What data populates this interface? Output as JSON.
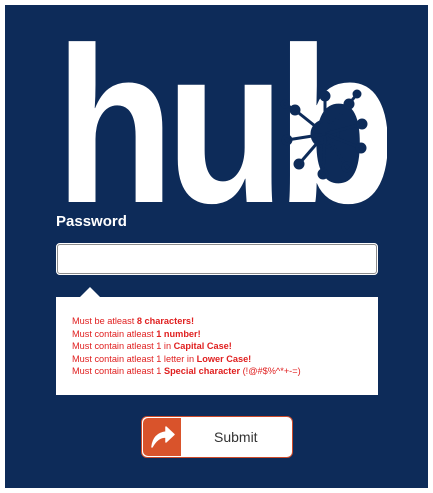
{
  "logo": {
    "text": "hub",
    "icon": "network-hub-icon"
  },
  "form": {
    "password_label": "Password",
    "password_value": "",
    "password_placeholder": ""
  },
  "rules": [
    {
      "pre": "Must be atleast ",
      "bold": "8 characters!",
      "post": ""
    },
    {
      "pre": "Must contain atleast ",
      "bold": "1 number!",
      "post": ""
    },
    {
      "pre": "Must contain atleast 1 in ",
      "bold": "Capital Case!",
      "post": ""
    },
    {
      "pre": "Must contain atleast 1 letter in ",
      "bold": "Lower Case!",
      "post": ""
    },
    {
      "pre": "Must contain atleast 1 ",
      "bold": "Special character",
      "post": " (!@#$%^*+-=)"
    }
  ],
  "submit": {
    "label": "Submit",
    "icon": "share-arrow-icon"
  },
  "colors": {
    "background": "#0d2b59",
    "error": "#e02020",
    "accent": "#d9532b"
  }
}
